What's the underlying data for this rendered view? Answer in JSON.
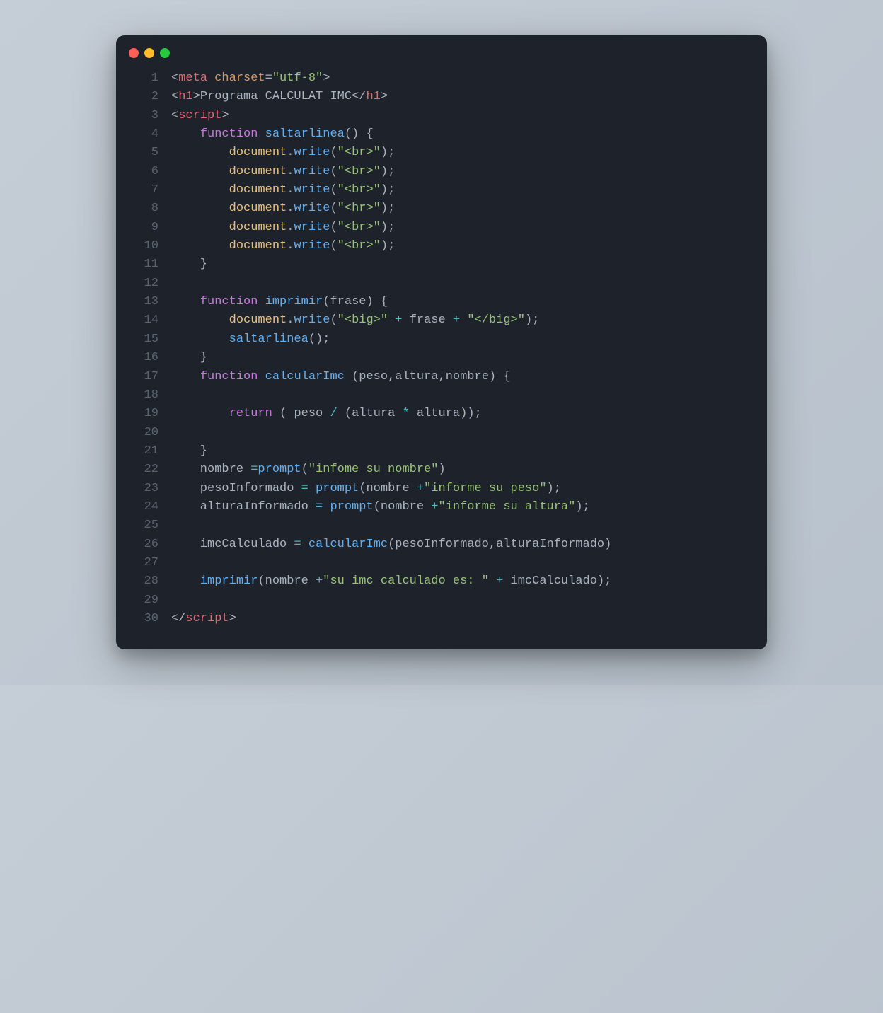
{
  "window": {
    "dots": [
      "red",
      "yellow",
      "green"
    ]
  },
  "code": {
    "lines": [
      {
        "n": 1,
        "tokens": [
          [
            "punct",
            "<"
          ],
          [
            "tag",
            "meta"
          ],
          [
            "text",
            " "
          ],
          [
            "attr",
            "charset"
          ],
          [
            "punct",
            "="
          ],
          [
            "string",
            "\"utf-8\""
          ],
          [
            "punct",
            ">"
          ]
        ]
      },
      {
        "n": 2,
        "tokens": [
          [
            "punct",
            "<"
          ],
          [
            "tag",
            "h1"
          ],
          [
            "punct",
            ">"
          ],
          [
            "text",
            "Programa CALCULAT IMC"
          ],
          [
            "punct",
            "</"
          ],
          [
            "tag",
            "h1"
          ],
          [
            "punct",
            ">"
          ]
        ]
      },
      {
        "n": 3,
        "tokens": [
          [
            "punct",
            "<"
          ],
          [
            "tag",
            "script"
          ],
          [
            "punct",
            ">"
          ]
        ]
      },
      {
        "n": 4,
        "tokens": [
          [
            "text",
            "    "
          ],
          [
            "kw",
            "function"
          ],
          [
            "text",
            " "
          ],
          [
            "fname",
            "saltarlinea"
          ],
          [
            "punct",
            "() {"
          ]
        ]
      },
      {
        "n": 5,
        "tokens": [
          [
            "text",
            "        "
          ],
          [
            "ident",
            "document"
          ],
          [
            "punct",
            "."
          ],
          [
            "fname",
            "write"
          ],
          [
            "punct",
            "("
          ],
          [
            "string",
            "\"<br>\""
          ],
          [
            "punct",
            ");"
          ]
        ]
      },
      {
        "n": 6,
        "tokens": [
          [
            "text",
            "        "
          ],
          [
            "ident",
            "document"
          ],
          [
            "punct",
            "."
          ],
          [
            "fname",
            "write"
          ],
          [
            "punct",
            "("
          ],
          [
            "string",
            "\"<br>\""
          ],
          [
            "punct",
            ");"
          ]
        ]
      },
      {
        "n": 7,
        "tokens": [
          [
            "text",
            "        "
          ],
          [
            "ident",
            "document"
          ],
          [
            "punct",
            "."
          ],
          [
            "fname",
            "write"
          ],
          [
            "punct",
            "("
          ],
          [
            "string",
            "\"<br>\""
          ],
          [
            "punct",
            ");"
          ]
        ]
      },
      {
        "n": 8,
        "tokens": [
          [
            "text",
            "        "
          ],
          [
            "ident",
            "document"
          ],
          [
            "punct",
            "."
          ],
          [
            "fname",
            "write"
          ],
          [
            "punct",
            "("
          ],
          [
            "string",
            "\"<hr>\""
          ],
          [
            "punct",
            ");"
          ]
        ]
      },
      {
        "n": 9,
        "tokens": [
          [
            "text",
            "        "
          ],
          [
            "ident",
            "document"
          ],
          [
            "punct",
            "."
          ],
          [
            "fname",
            "write"
          ],
          [
            "punct",
            "("
          ],
          [
            "string",
            "\"<br>\""
          ],
          [
            "punct",
            ");"
          ]
        ]
      },
      {
        "n": 10,
        "tokens": [
          [
            "text",
            "        "
          ],
          [
            "ident",
            "document"
          ],
          [
            "punct",
            "."
          ],
          [
            "fname",
            "write"
          ],
          [
            "punct",
            "("
          ],
          [
            "string",
            "\"<br>\""
          ],
          [
            "punct",
            ");"
          ]
        ]
      },
      {
        "n": 11,
        "tokens": [
          [
            "text",
            "    }"
          ]
        ]
      },
      {
        "n": 12,
        "tokens": [
          [
            "text",
            ""
          ]
        ]
      },
      {
        "n": 13,
        "tokens": [
          [
            "text",
            "    "
          ],
          [
            "kw",
            "function"
          ],
          [
            "text",
            " "
          ],
          [
            "fname",
            "imprimir"
          ],
          [
            "punct",
            "("
          ],
          [
            "param",
            "frase"
          ],
          [
            "punct",
            ") {"
          ]
        ]
      },
      {
        "n": 14,
        "tokens": [
          [
            "text",
            "        "
          ],
          [
            "ident",
            "document"
          ],
          [
            "punct",
            "."
          ],
          [
            "fname",
            "write"
          ],
          [
            "punct",
            "("
          ],
          [
            "string",
            "\"<big>\""
          ],
          [
            "text",
            " "
          ],
          [
            "op",
            "+"
          ],
          [
            "text",
            " frase "
          ],
          [
            "op",
            "+"
          ],
          [
            "text",
            " "
          ],
          [
            "string",
            "\"</big>\""
          ],
          [
            "punct",
            ");"
          ]
        ]
      },
      {
        "n": 15,
        "tokens": [
          [
            "text",
            "        "
          ],
          [
            "fname",
            "saltarlinea"
          ],
          [
            "punct",
            "();"
          ]
        ]
      },
      {
        "n": 16,
        "tokens": [
          [
            "text",
            "    }"
          ]
        ]
      },
      {
        "n": 17,
        "tokens": [
          [
            "text",
            "    "
          ],
          [
            "kw",
            "function"
          ],
          [
            "text",
            " "
          ],
          [
            "fname",
            "calcularImc"
          ],
          [
            "text",
            " "
          ],
          [
            "punct",
            "("
          ],
          [
            "param",
            "peso"
          ],
          [
            "punct",
            ","
          ],
          [
            "param",
            "altura"
          ],
          [
            "punct",
            ","
          ],
          [
            "param",
            "nombre"
          ],
          [
            "punct",
            ") {"
          ]
        ]
      },
      {
        "n": 18,
        "tokens": [
          [
            "text",
            ""
          ]
        ]
      },
      {
        "n": 19,
        "tokens": [
          [
            "text",
            "        "
          ],
          [
            "kw",
            "return"
          ],
          [
            "text",
            " ( peso "
          ],
          [
            "op",
            "/"
          ],
          [
            "text",
            " (altura "
          ],
          [
            "op",
            "*"
          ],
          [
            "text",
            " altura));"
          ]
        ]
      },
      {
        "n": 20,
        "tokens": [
          [
            "text",
            ""
          ]
        ]
      },
      {
        "n": 21,
        "tokens": [
          [
            "text",
            "    }"
          ]
        ]
      },
      {
        "n": 22,
        "tokens": [
          [
            "text",
            "    nombre "
          ],
          [
            "op",
            "="
          ],
          [
            "fname",
            "prompt"
          ],
          [
            "punct",
            "("
          ],
          [
            "string",
            "\"infome su nombre\""
          ],
          [
            "punct",
            ")"
          ]
        ]
      },
      {
        "n": 23,
        "tokens": [
          [
            "text",
            "    pesoInformado "
          ],
          [
            "op",
            "="
          ],
          [
            "text",
            " "
          ],
          [
            "fname",
            "prompt"
          ],
          [
            "punct",
            "("
          ],
          [
            "text",
            "nombre "
          ],
          [
            "op",
            "+"
          ],
          [
            "string",
            "\"informe su peso\""
          ],
          [
            "punct",
            ");"
          ]
        ]
      },
      {
        "n": 24,
        "tokens": [
          [
            "text",
            "    alturaInformado "
          ],
          [
            "op",
            "="
          ],
          [
            "text",
            " "
          ],
          [
            "fname",
            "prompt"
          ],
          [
            "punct",
            "("
          ],
          [
            "text",
            "nombre "
          ],
          [
            "op",
            "+"
          ],
          [
            "string",
            "\"informe su altura\""
          ],
          [
            "punct",
            ");"
          ]
        ]
      },
      {
        "n": 25,
        "tokens": [
          [
            "text",
            ""
          ]
        ]
      },
      {
        "n": 26,
        "tokens": [
          [
            "text",
            "    imcCalculado "
          ],
          [
            "op",
            "="
          ],
          [
            "text",
            " "
          ],
          [
            "fname",
            "calcularImc"
          ],
          [
            "punct",
            "("
          ],
          [
            "text",
            "pesoInformado"
          ],
          [
            "punct",
            ","
          ],
          [
            "text",
            "alturaInformado"
          ],
          [
            "punct",
            ")"
          ]
        ]
      },
      {
        "n": 27,
        "tokens": [
          [
            "text",
            ""
          ]
        ]
      },
      {
        "n": 28,
        "tokens": [
          [
            "text",
            "    "
          ],
          [
            "fname",
            "imprimir"
          ],
          [
            "punct",
            "("
          ],
          [
            "text",
            "nombre "
          ],
          [
            "op",
            "+"
          ],
          [
            "string",
            "\"su imc calculado es: \""
          ],
          [
            "text",
            " "
          ],
          [
            "op",
            "+"
          ],
          [
            "text",
            " imcCalculado"
          ],
          [
            "punct",
            ");"
          ]
        ]
      },
      {
        "n": 29,
        "tokens": [
          [
            "text",
            ""
          ]
        ]
      },
      {
        "n": 30,
        "tokens": [
          [
            "punct",
            "</"
          ],
          [
            "tag",
            "script"
          ],
          [
            "punct",
            ">"
          ]
        ]
      }
    ]
  }
}
